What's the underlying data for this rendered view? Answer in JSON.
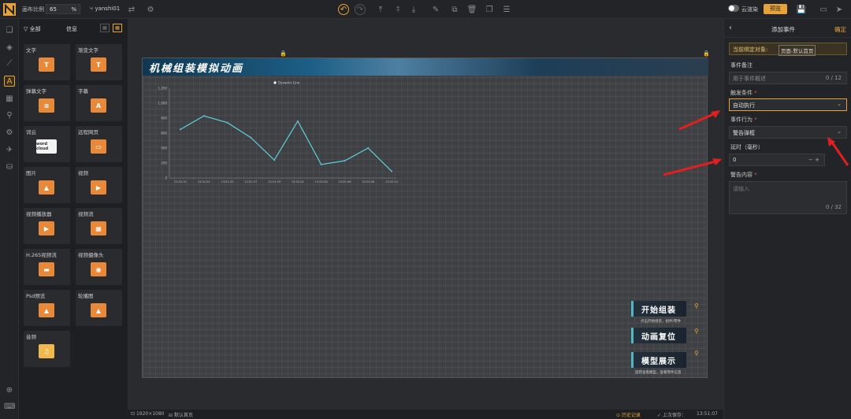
{
  "topbar": {
    "scale_label": "画布比例",
    "scale_value": "65",
    "scale_unit": "%",
    "user": "yanshi01",
    "cloud_label": "云渲染",
    "preview_label": "预览"
  },
  "panel": {
    "tab_all": "全部",
    "tab_info": "信息",
    "components": [
      {
        "label": "文字",
        "icon": "T"
      },
      {
        "label": "渐变文字",
        "icon": "T"
      },
      {
        "label": "弹幕文字",
        "icon": "≡"
      },
      {
        "label": "字幕",
        "icon": "A"
      },
      {
        "label": "词云",
        "icon": "word cloud"
      },
      {
        "label": "远程网页",
        "icon": "▭"
      },
      {
        "label": "图片",
        "icon": "▲"
      },
      {
        "label": "视频",
        "icon": "▶"
      },
      {
        "label": "视频播放器",
        "icon": "▶"
      },
      {
        "label": "视频流",
        "icon": "▦"
      },
      {
        "label": "H.265视频流",
        "icon": "▬"
      },
      {
        "label": "视频摄像头",
        "icon": "◉"
      },
      {
        "label": "Psd预览",
        "icon": "▲"
      },
      {
        "label": "轮播图",
        "icon": "▲"
      },
      {
        "label": "音频",
        "icon": "♫"
      }
    ]
  },
  "stage": {
    "title": "机械组装模拟动画",
    "buttons": [
      {
        "label": "开始组装",
        "sub": "点击开始组装，组件/零件"
      },
      {
        "label": "动画复位",
        "sub": ""
      },
      {
        "label": "模型展示",
        "sub": "旋转查看模型，查看零件信息"
      }
    ]
  },
  "chart_data": {
    "type": "line",
    "legend": [
      "Dynamic Line"
    ],
    "categories": [
      "13:51:51",
      "13:51:52",
      "13:51:55",
      "13:51:57",
      "13:51:59",
      "13:52:01",
      "13:52:04",
      "13:52:06",
      "13:52:08",
      "13:52:10"
    ],
    "series": [
      {
        "name": "Dynamic Line",
        "values": [
          650,
          830,
          740,
          540,
          240,
          760,
          180,
          230,
          400,
          90
        ]
      }
    ],
    "y_ticks": [
      "0",
      "200",
      "400",
      "600",
      "800",
      "1,000",
      "1,200"
    ],
    "ylim": [
      0,
      1200
    ],
    "color": "#5fd0d8"
  },
  "bottom": {
    "resolution": "1920×1080",
    "default_page": "默认首页",
    "history": "历史记录",
    "last_saved": "上次保存：",
    "time": "13:51:07"
  },
  "right_panel": {
    "title": "添加事件",
    "confirm": "确定",
    "bind_label": "当前绑定对象:",
    "bind_value": "页面-默认首页",
    "remark_label": "事件备注",
    "remark_placeholder": "用于事件概述",
    "remark_count": "0 / 12",
    "trigger_label": "触发条件",
    "trigger_value": "自动执行",
    "action_label": "事件行为",
    "action_value": "警告弹框",
    "delay_label": "延时（毫秒）",
    "delay_value": "0",
    "content_label": "警告内容",
    "content_placeholder": "请输入",
    "content_count": "0 / 32"
  }
}
